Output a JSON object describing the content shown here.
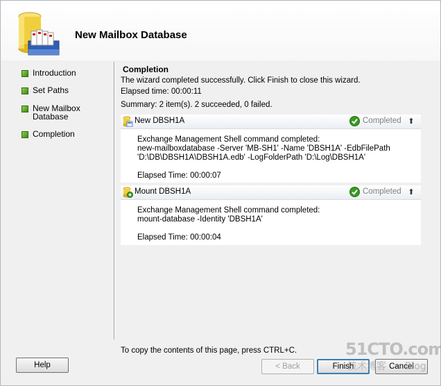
{
  "wizard": {
    "title": "New Mailbox Database"
  },
  "nav": {
    "items": [
      {
        "label": "Introduction"
      },
      {
        "label": "Set Paths"
      },
      {
        "label": "New Mailbox Database"
      },
      {
        "label": "Completion"
      }
    ]
  },
  "completion": {
    "title": "Completion",
    "message": "The wizard completed successfully. Click Finish to close this wizard.",
    "elapsed": "Elapsed time: 00:00:11",
    "summary": "Summary: 2 item(s). 2 succeeded, 0 failed."
  },
  "tasks": [
    {
      "name": "New DBSH1A",
      "status": "Completed",
      "line1": "Exchange Management Shell command completed:",
      "line2": "new-mailboxdatabase -Server 'MB-SH1' -Name 'DBSH1A' -EdbFilePath",
      "line3": "'D:\\DB\\DBSH1A\\DBSH1A.edb' -LogFolderPath 'D:\\Log\\DBSH1A'",
      "elapsed": "Elapsed Time: 00:00:07"
    },
    {
      "name": "Mount DBSH1A",
      "status": "Completed",
      "line1": "Exchange Management Shell command completed:",
      "line2": "mount-database -Identity 'DBSH1A'",
      "elapsed": "Elapsed Time: 00:00:04"
    }
  ],
  "footer": {
    "note": "To copy the contents of this page, press CTRL+C.",
    "help": "Help",
    "back": "< Back",
    "finish": "Finish",
    "cancel": "Cancel"
  },
  "watermark": {
    "main": "51CTO.com",
    "sub": "技术博客",
    "tail": "Blog"
  },
  "colors": {
    "accent": "#3c7fb1",
    "success": "#3a9b22",
    "muted": "#808080"
  }
}
